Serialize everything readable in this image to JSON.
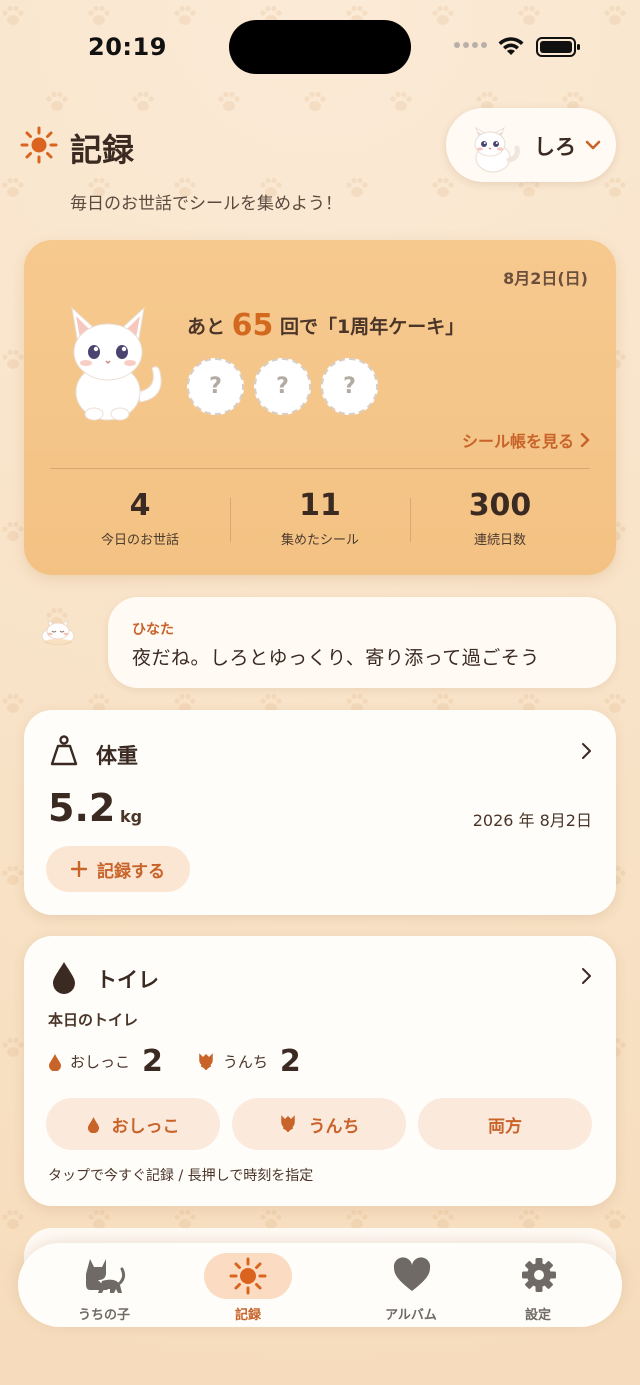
{
  "status_bar": {
    "time": "20:19"
  },
  "header": {
    "title": "記録",
    "subtitle": "毎日のお世話でシールを集めよう！",
    "pet_name": "しろ"
  },
  "sticker_card": {
    "date": "8月2日(日)",
    "msg_prefix": "あと",
    "remaining": "65",
    "msg_suffix": "回で「1周年ケーキ」",
    "slots": [
      "?",
      "?",
      "?"
    ],
    "link_label": "シール帳を見る",
    "stats": [
      {
        "value": "4",
        "label": "今日のお世話"
      },
      {
        "value": "11",
        "label": "集めたシール"
      },
      {
        "value": "300",
        "label": "連続日数"
      }
    ]
  },
  "message": {
    "speaker": "ひなた",
    "text": "夜だね。しろとゆっくり、寄り添って過ごそう"
  },
  "weight_card": {
    "title": "体重",
    "value": "5.2",
    "unit": "kg",
    "date": "2026 年 8月2日",
    "record_label": "記録する"
  },
  "toilet_card": {
    "title": "トイレ",
    "subtitle": "本日のトイレ",
    "pee_label": "おしっこ",
    "pee_count": "2",
    "poop_label": "うんち",
    "poop_count": "2",
    "buttons": [
      "おしっこ",
      "うんち",
      "両方"
    ],
    "hint": "タップで今すぐ記録 / 長押しで時刻を指定"
  },
  "tabbar": {
    "tabs": [
      {
        "label": "うちの子",
        "icon": "cat-icon",
        "active": false
      },
      {
        "label": "記録",
        "icon": "sun-icon",
        "active": true
      },
      {
        "label": "アルバム",
        "icon": "heart-icon",
        "active": false
      },
      {
        "label": "設定",
        "icon": "gear-icon",
        "active": false
      }
    ]
  },
  "colors": {
    "accent": "#c8632a",
    "background": "#f9e6cc",
    "sticker_card": "#f5c68a"
  }
}
